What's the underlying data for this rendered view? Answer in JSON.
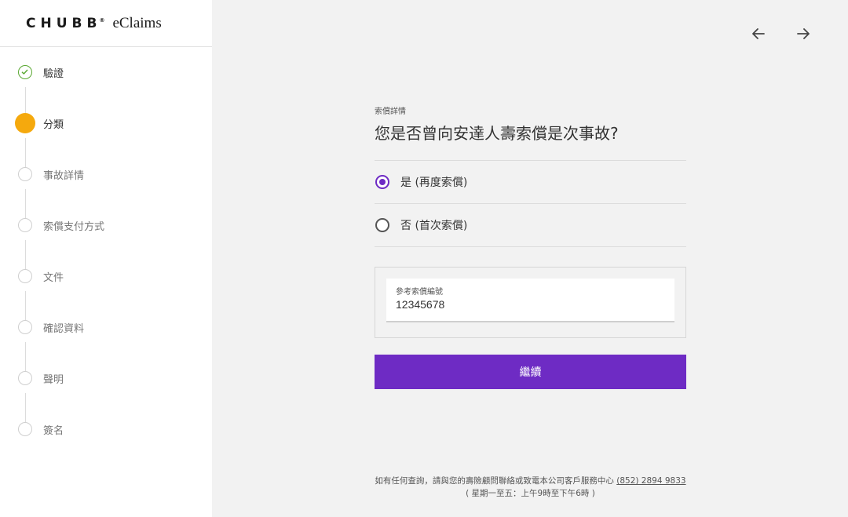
{
  "brand": {
    "logo": "CHUBB",
    "sub": "eClaims",
    "reg": "®"
  },
  "steps": [
    {
      "label": "驗證",
      "state": "done"
    },
    {
      "label": "分類",
      "state": "active"
    },
    {
      "label": "事故詳情",
      "state": "pending"
    },
    {
      "label": "索償支付方式",
      "state": "pending"
    },
    {
      "label": "文件",
      "state": "pending"
    },
    {
      "label": "確認資料",
      "state": "pending"
    },
    {
      "label": "聲明",
      "state": "pending"
    },
    {
      "label": "簽名",
      "state": "pending"
    }
  ],
  "nav": {
    "back_icon": "arrow-left-icon",
    "forward_icon": "arrow-right-icon"
  },
  "main": {
    "section_label": "索償詳情",
    "question": "您是否曾向安達人壽索償是次事故?",
    "options": [
      {
        "label": "是 (再度索償)",
        "checked": true
      },
      {
        "label": "否 (首次索償)",
        "checked": false
      }
    ],
    "reference_field": {
      "label": "參考索償編號",
      "value": "12345678"
    },
    "continue_label": "繼續"
  },
  "footer": {
    "line1": "如有任何查詢，請與您的壽險顧問聯絡或致電本公司客戶服務中心",
    "phone": "(852) 2894 9833",
    "line2": "( 星期一至五：上午9時至下午6時 )"
  },
  "colors": {
    "accent": "#6e2bc4",
    "active_step": "#f5a90d",
    "done_step": "#5aa832"
  }
}
